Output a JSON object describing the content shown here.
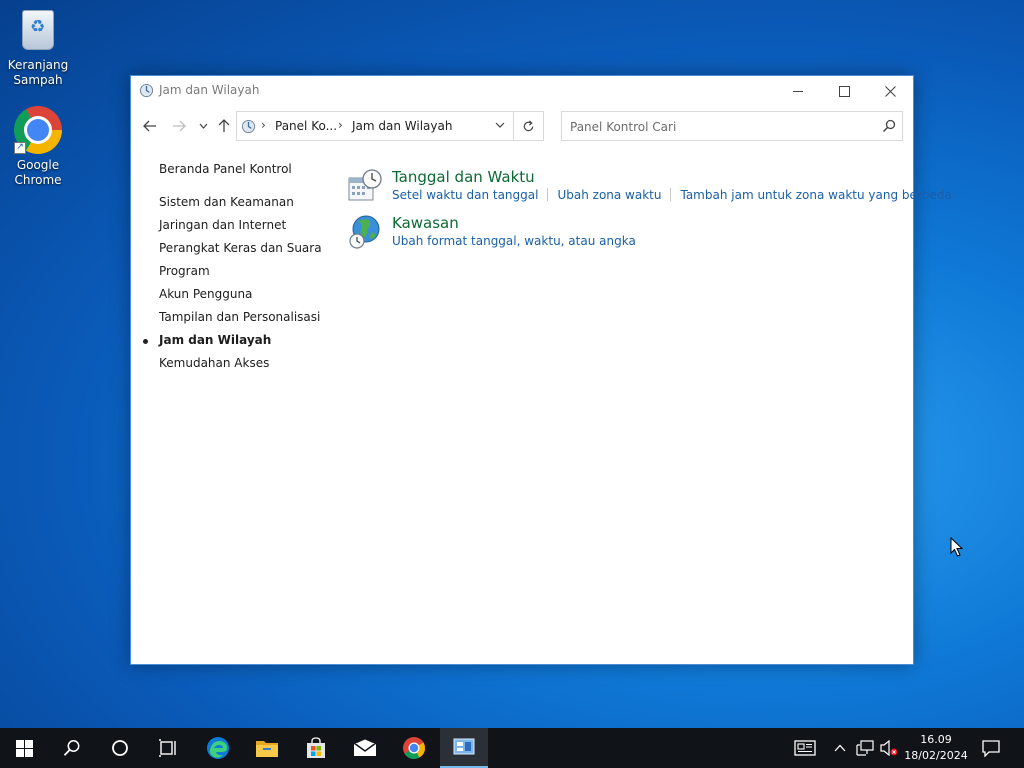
{
  "desktop": {
    "icons": [
      {
        "label_line1": "Keranjang",
        "label_line2": "Sampah",
        "icon": "recycle-bin-icon"
      },
      {
        "label_line1": "Google",
        "label_line2": "Chrome",
        "icon": "chrome-icon"
      }
    ]
  },
  "window": {
    "title": "Jam dan Wilayah",
    "address": {
      "crumbs": [
        "Panel Ko...",
        "Jam dan Wilayah"
      ]
    },
    "search_placeholder": "Panel Kontrol Cari",
    "sidebar": {
      "home": "Beranda Panel Kontrol",
      "items": [
        "Sistem dan Keamanan",
        "Jaringan dan Internet",
        "Perangkat Keras dan Suara",
        "Program",
        "Akun Pengguna",
        "Tampilan dan Personalisasi",
        "Jam dan Wilayah",
        "Kemudahan Akses"
      ],
      "active_index": 6
    },
    "categories": [
      {
        "title": "Tanggal dan Waktu",
        "icon": "date-time-icon",
        "links": [
          "Setel waktu dan tanggal",
          "Ubah zona waktu",
          "Tambah jam untuk zona waktu yang berbeda"
        ]
      },
      {
        "title": "Kawasan",
        "icon": "region-globe-icon",
        "links": [
          "Ubah format tanggal, waktu, atau angka"
        ]
      }
    ]
  },
  "taskbar": {
    "time": "16.09",
    "date": "18/02/2024"
  },
  "colors": {
    "category_title": "#0c6a35",
    "link": "#1a5fa8",
    "taskbar": "#101317",
    "accent": "#76b9ed"
  }
}
